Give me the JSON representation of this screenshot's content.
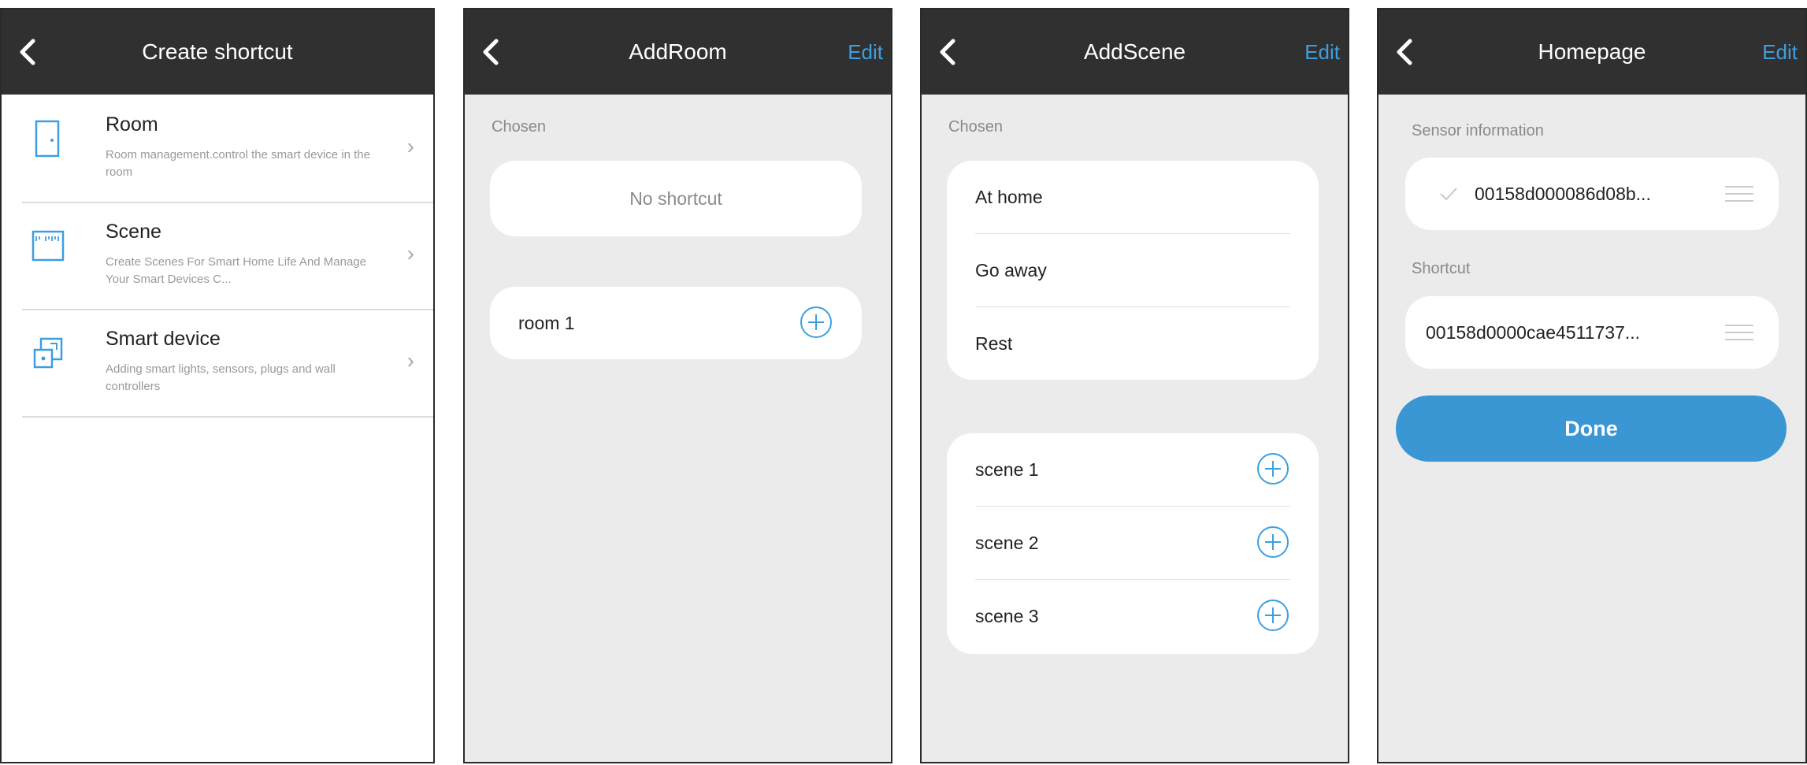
{
  "screens": {
    "create_shortcut": {
      "title": "Create shortcut",
      "items": [
        {
          "title": "Room",
          "description": "Room management.control the smart device in the room"
        },
        {
          "title": "Scene",
          "description": "Create Scenes For Smart Home Life And Manage Your Smart Devices C..."
        },
        {
          "title": "Smart device",
          "description": "Adding smart lights, sensors, plugs and wall controllers"
        }
      ]
    },
    "add_room": {
      "title": "AddRoom",
      "edit_label": "Edit",
      "chosen_label": "Chosen",
      "empty_text": "No shortcut",
      "rooms": [
        "room 1"
      ]
    },
    "add_scene": {
      "title": "AddScene",
      "edit_label": "Edit",
      "chosen_label": "Chosen",
      "chosen": [
        "At home",
        "Go away",
        "Rest"
      ],
      "available": [
        "scene 1",
        "scene 2",
        "scene 3"
      ]
    },
    "homepage": {
      "title": "Homepage",
      "edit_label": "Edit",
      "sensor_label": "Sensor information",
      "sensor_value": "00158d000086d08b...",
      "shortcut_label": "Shortcut",
      "shortcut_value": "00158d0000cae4511737...",
      "done_label": "Done"
    }
  },
  "colors": {
    "navbar": "#303030",
    "accent": "#3d9fe0",
    "button": "#3a97d4",
    "background": "#ebebeb"
  },
  "icons": [
    "back-icon",
    "door-icon",
    "scene-icon",
    "smart-device-icon",
    "chevron-right-icon",
    "add-circle-icon",
    "check-icon",
    "drag-handle-icon"
  ]
}
